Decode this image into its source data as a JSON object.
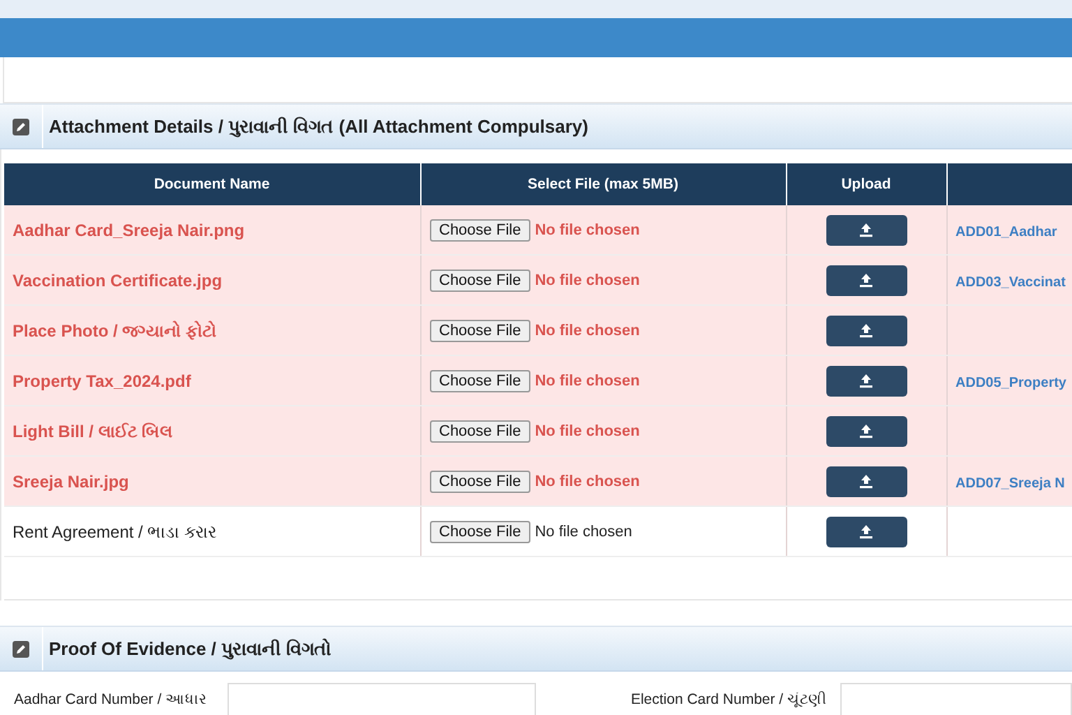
{
  "attachments": {
    "title": "Attachment Details / પુરાવાની વિગત (All Attachment Compulsary)",
    "columns": [
      "Document Name",
      "Select File (max 5MB)",
      "Upload"
    ],
    "rows": [
      {
        "name": "Aadhar Card_Sreeja Nair.png",
        "button": "Choose File",
        "file_status": "No file chosen",
        "error": true,
        "link": "ADD01_Aadhar"
      },
      {
        "name": "Vaccination Certificate.jpg",
        "button": "Choose File",
        "file_status": "No file chosen",
        "error": true,
        "link": "ADD03_Vaccinat"
      },
      {
        "name": "Place Photo / જગ્યાનો ફોટો",
        "button": "Choose File",
        "file_status": "No file chosen",
        "error": true
      },
      {
        "name": "Property Tax_2024.pdf",
        "button": "Choose File",
        "file_status": "No file chosen",
        "error": true,
        "link": "ADD05_Property"
      },
      {
        "name": "Light Bill / લાઈટ બિલ",
        "button": "Choose File",
        "file_status": "No file chosen",
        "error": true
      },
      {
        "name": "Sreeja Nair.jpg",
        "button": "Choose File",
        "file_status": "No file chosen",
        "error": true,
        "link": "ADD07_Sreeja N"
      },
      {
        "name": "Rent Agreement / ભાડા કરાર",
        "button": "Choose File",
        "file_status": "No file chosen",
        "error": false
      }
    ]
  },
  "evidence": {
    "title": "Proof Of Evidence / પુરાવાની વિગતો",
    "fields": [
      {
        "label": "Aadhar Card Number / આધાર"
      },
      {
        "label": "Election Card Number / ચૂંટણી"
      }
    ]
  }
}
